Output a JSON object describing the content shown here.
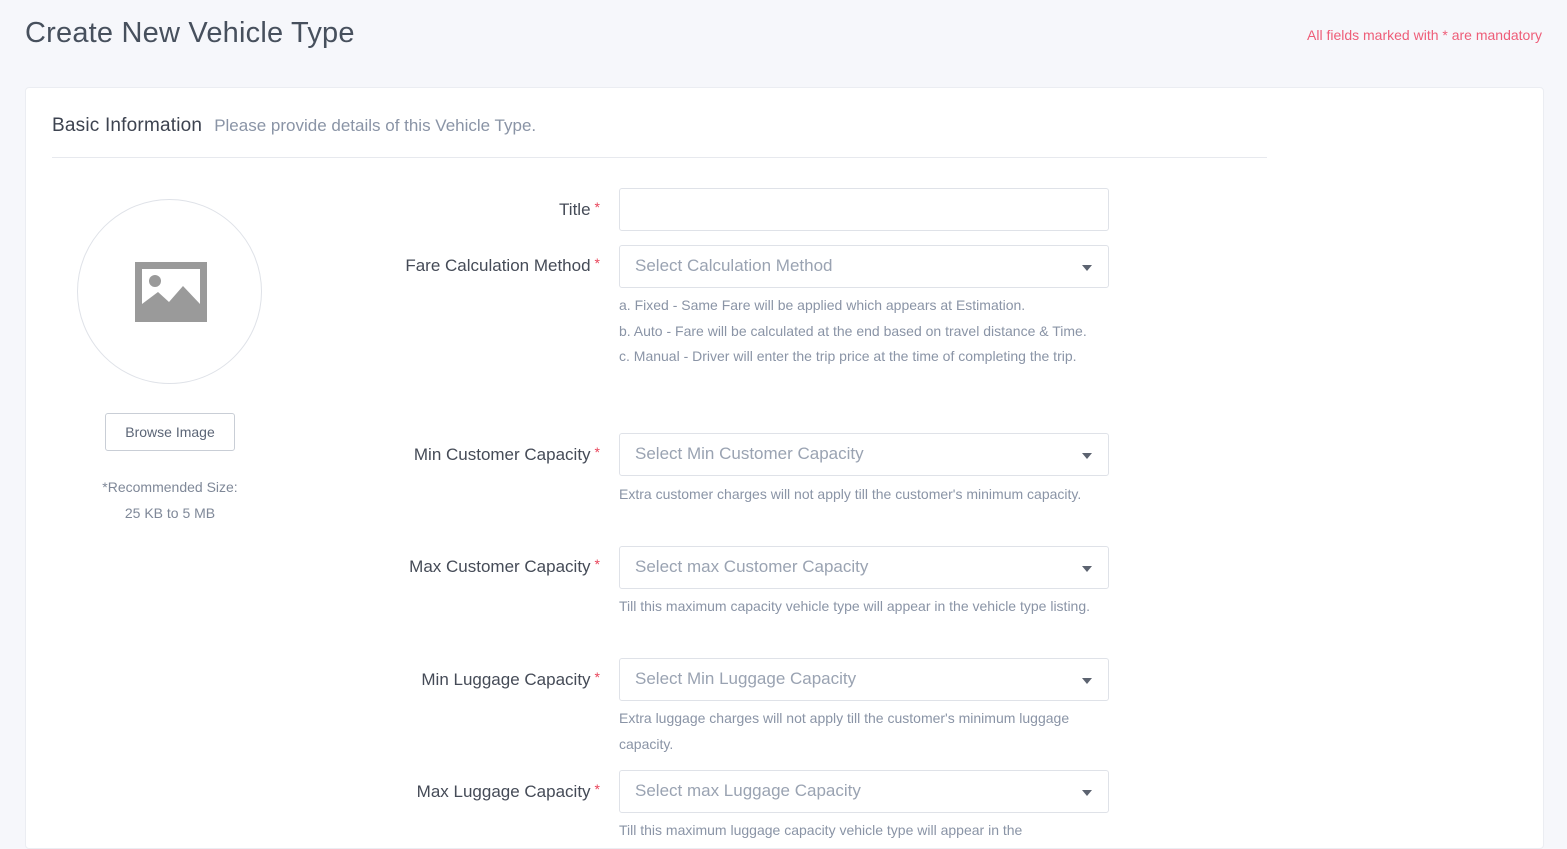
{
  "header": {
    "title": "Create New Vehicle Type",
    "mandatory_note": "All fields marked with * are mandatory"
  },
  "section": {
    "title": "Basic Information",
    "subtitle": "Please provide details of this Vehicle Type."
  },
  "image_upload": {
    "icon": "image-placeholder-icon",
    "button_label": "Browse Image",
    "recommended_line1": "*Recommended Size:",
    "recommended_line2": "25 KB to 5 MB"
  },
  "fields": {
    "title": {
      "label": "Title",
      "required_mark": "*",
      "value": ""
    },
    "fare_method": {
      "label": "Fare Calculation Method",
      "required_mark": "*",
      "placeholder": "Select Calculation Method",
      "help": [
        "a. Fixed - Same Fare will be applied which appears at Estimation.",
        "b. Auto - Fare will be calculated at the end based on travel distance & Time.",
        "c. Manual - Driver will enter the trip price at the time of completing the trip."
      ]
    },
    "min_customer": {
      "label": "Min Customer Capacity",
      "required_mark": "*",
      "placeholder": "Select Min Customer Capacity",
      "help": "Extra customer charges will not apply till the customer's minimum capacity."
    },
    "max_customer": {
      "label": "Max Customer Capacity",
      "required_mark": "*",
      "placeholder": "Select max Customer Capacity",
      "help": "Till this maximum capacity vehicle type will appear in the vehicle type listing."
    },
    "min_luggage": {
      "label": "Min Luggage Capacity",
      "required_mark": "*",
      "placeholder": "Select Min Luggage Capacity",
      "help": "Extra luggage charges will not apply till the customer's minimum luggage capacity."
    },
    "max_luggage": {
      "label": "Max Luggage Capacity",
      "required_mark": "*",
      "placeholder": "Select max Luggage Capacity",
      "help": "Till this maximum luggage capacity vehicle type will appear in the"
    }
  },
  "colors": {
    "page_background": "#f6f7fb",
    "mandatory_accent": "#ee5d78",
    "required_star": "#e8445a",
    "placeholder_text": "#9aa3b2"
  }
}
